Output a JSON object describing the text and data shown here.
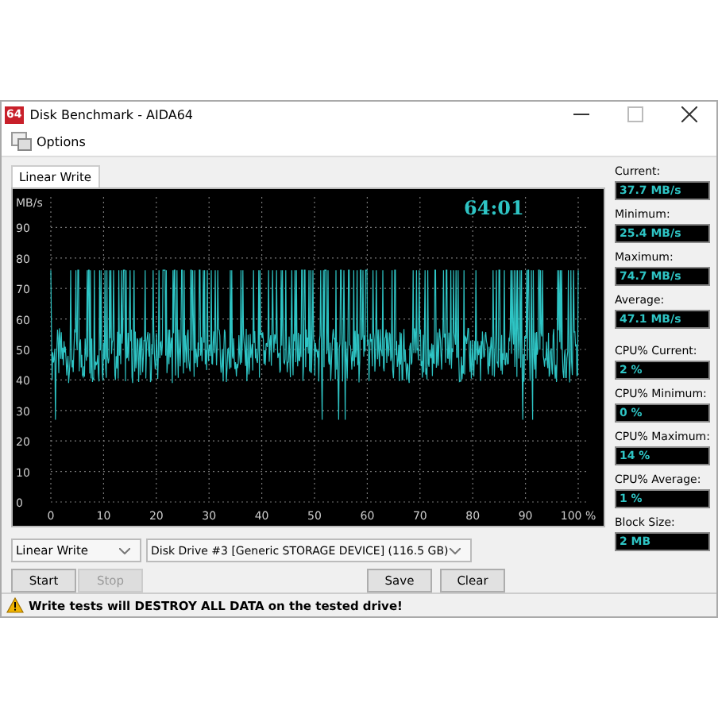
{
  "window": {
    "title": "Disk Benchmark - AIDA64",
    "app_icon": "64"
  },
  "menu": [
    {
      "label": "Options"
    }
  ],
  "tabs": [
    {
      "label": "Linear Write",
      "selected": true
    }
  ],
  "chart": {
    "unit": "MB/s",
    "timer": "64:01",
    "y_labels": [
      "90",
      "80",
      "70",
      "60",
      "50",
      "40",
      "30",
      "20",
      "10",
      "0"
    ],
    "x_labels": [
      "0",
      "10",
      "20",
      "30",
      "40",
      "50",
      "60",
      "70",
      "80",
      "90",
      "100 %"
    ]
  },
  "stat_groups": [
    [
      {
        "label": "Current:",
        "value": "37.7 MB/s"
      },
      {
        "label": "Minimum:",
        "value": "25.4 MB/s"
      },
      {
        "label": "Maximum:",
        "value": "74.7 MB/s"
      },
      {
        "label": "Average:",
        "value": "47.1 MB/s"
      }
    ],
    [
      {
        "label": "CPU% Current:",
        "value": "2 %"
      },
      {
        "label": "CPU% Minimum:",
        "value": "0 %"
      },
      {
        "label": "CPU% Maximum:",
        "value": "14 %"
      },
      {
        "label": "CPU% Average:",
        "value": "1 %"
      },
      {
        "label": "Block Size:",
        "value": "2 MB"
      }
    ]
  ],
  "test_select": {
    "value": "Linear Write"
  },
  "drive_select": {
    "value": "Disk Drive #3  [Generic STORAGE DEVICE]  (116.5 GB)"
  },
  "buttons": [
    {
      "label": "Start",
      "disabled": false
    },
    {
      "label": "Stop",
      "disabled": true
    },
    {
      "label": "Save",
      "disabled": false
    },
    {
      "label": "Clear",
      "disabled": false
    }
  ],
  "status": {
    "message": "Write tests will DESTROY ALL DATA on the tested drive!"
  }
}
